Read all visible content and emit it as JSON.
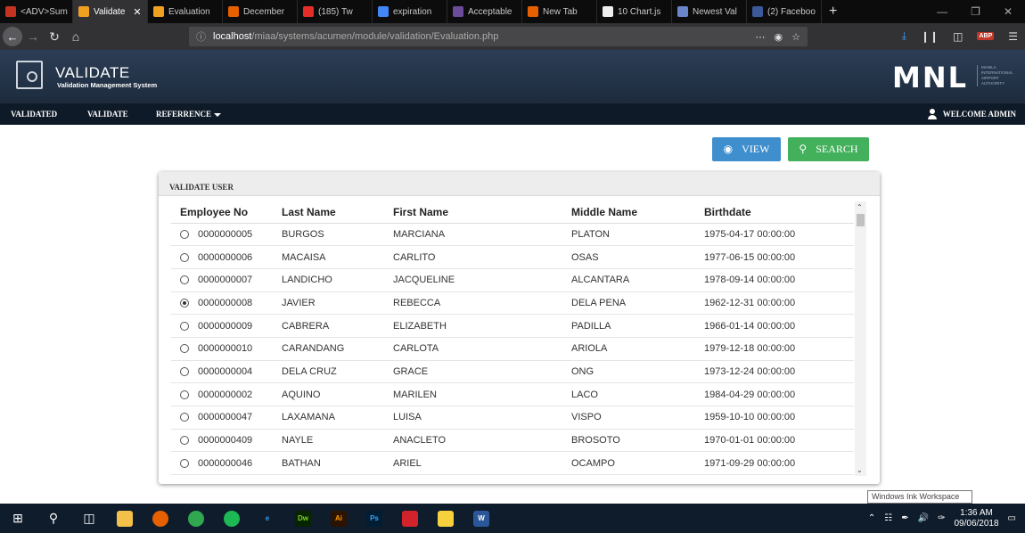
{
  "browser": {
    "tabs": [
      {
        "label": "<ADV>Sum",
        "icon": "gmail-icon",
        "color": "#c23321"
      },
      {
        "label": "Validate",
        "icon": "xampp-icon",
        "color": "#f0a020",
        "active": true
      },
      {
        "label": "Evaluation",
        "icon": "xampp-icon",
        "color": "#f0a020"
      },
      {
        "label": "December",
        "icon": "firefox-feed-icon",
        "color": "#e66000"
      },
      {
        "label": "(185) Tw",
        "icon": "youtube-icon",
        "color": "#e52d27"
      },
      {
        "label": "expiration",
        "icon": "google-icon",
        "color": "#4285f4"
      },
      {
        "label": "Acceptable",
        "icon": "acceptable-icon",
        "color": "#6b4c9a"
      },
      {
        "label": "New Tab",
        "icon": "firefox-icon",
        "color": "#e66000"
      },
      {
        "label": "10 Chart.js",
        "icon": "chart-icon",
        "color": "#eeeeee"
      },
      {
        "label": "Newest Val",
        "icon": "stack-icon",
        "color": "#6a85c8"
      },
      {
        "label": "(2) Faceboo",
        "icon": "facebook-icon",
        "color": "#3b5998"
      }
    ],
    "url_host": "localhost",
    "url_path": "/miaa/systems/acumen/module/validation/Evaluation.php"
  },
  "header": {
    "title": "VALIDATE",
    "subtitle": "Validation Management System",
    "logo_text": "MNL",
    "logo_sub": "MANILA INTERNATIONAL AIRPORT AUTHORITY"
  },
  "menu": {
    "items": [
      "VALIDATED",
      "VALIDATE",
      "REFERRENCE"
    ],
    "welcome": "WELCOME ADMIN"
  },
  "actions": {
    "view": "VIEW",
    "search": "SEARCH"
  },
  "card": {
    "title": "VALIDATE USER",
    "columns": [
      "Employee No",
      "Last Name",
      "First Name",
      "Middle Name",
      "Birthdate"
    ],
    "rows": [
      {
        "emp": "0000000005",
        "last": "BURGOS",
        "first": "MARCIANA",
        "middle": "PLATON",
        "birth": "1975-04-17 00:00:00",
        "selected": false
      },
      {
        "emp": "0000000006",
        "last": "MACAISA",
        "first": "CARLITO",
        "middle": "OSAS",
        "birth": "1977-06-15 00:00:00",
        "selected": false
      },
      {
        "emp": "0000000007",
        "last": "LANDICHO",
        "first": "JACQUELINE",
        "middle": "ALCANTARA",
        "birth": "1978-09-14 00:00:00",
        "selected": false
      },
      {
        "emp": "0000000008",
        "last": "JAVIER",
        "first": "REBECCA",
        "middle": "DELA PENA",
        "birth": "1962-12-31 00:00:00",
        "selected": true
      },
      {
        "emp": "0000000009",
        "last": "CABRERA",
        "first": "ELIZABETH",
        "middle": "PADILLA",
        "birth": "1966-01-14 00:00:00",
        "selected": false
      },
      {
        "emp": "0000000010",
        "last": "CARANDANG",
        "first": "CARLOTA",
        "middle": "ARIOLA",
        "birth": "1979-12-18 00:00:00",
        "selected": false
      },
      {
        "emp": "0000000004",
        "last": "DELA CRUZ",
        "first": "GRACE",
        "middle": "ONG",
        "birth": "1973-12-24 00:00:00",
        "selected": false
      },
      {
        "emp": "0000000002",
        "last": "AQUINO",
        "first": "MARILEN",
        "middle": "LACO",
        "birth": "1984-04-29 00:00:00",
        "selected": false
      },
      {
        "emp": "0000000047",
        "last": "LAXAMANA",
        "first": "LUISA",
        "middle": "VISPO",
        "birth": "1959-10-10 00:00:00",
        "selected": false
      },
      {
        "emp": "0000000409",
        "last": "NAYLE",
        "first": "ANACLETO",
        "middle": "BROSOTO",
        "birth": "1970-01-01 00:00:00",
        "selected": false
      },
      {
        "emp": "0000000046",
        "last": "BATHAN",
        "first": "ARIEL",
        "middle": "OCAMPO",
        "birth": "1971-09-29 00:00:00",
        "selected": false
      }
    ]
  },
  "tooltip": "Windows Ink Workspace",
  "taskbar": {
    "apps": [
      {
        "name": "file-explorer-icon",
        "label": "",
        "bg": "#f3c04a",
        "fg": "#2a5a9a"
      },
      {
        "name": "firefox-icon",
        "label": "",
        "bg": "#e66000",
        "fg": "#fff"
      },
      {
        "name": "chrome-icon",
        "label": "",
        "bg": "#2fa84f",
        "fg": "#fff"
      },
      {
        "name": "spotify-icon",
        "label": "",
        "bg": "#1db954",
        "fg": "#000"
      },
      {
        "name": "edge-icon",
        "label": "e",
        "bg": "#0f1c2c",
        "fg": "#2d9bf0"
      },
      {
        "name": "dreamweaver-icon",
        "label": "Dw",
        "bg": "#072401",
        "fg": "#7ed321"
      },
      {
        "name": "illustrator-icon",
        "label": "Ai",
        "bg": "#2b1300",
        "fg": "#ff9a00"
      },
      {
        "name": "photoshop-icon",
        "label": "Ps",
        "bg": "#001d34",
        "fg": "#31a8ff"
      },
      {
        "name": "garena-icon",
        "label": "",
        "bg": "#d2232a",
        "fg": "#fff"
      },
      {
        "name": "sticky-notes-icon",
        "label": "",
        "bg": "#f7d13d",
        "fg": "#000"
      },
      {
        "name": "word-icon",
        "label": "W",
        "bg": "#2b579a",
        "fg": "#fff"
      }
    ],
    "time": "1:36 AM",
    "date": "09/06/2018"
  }
}
